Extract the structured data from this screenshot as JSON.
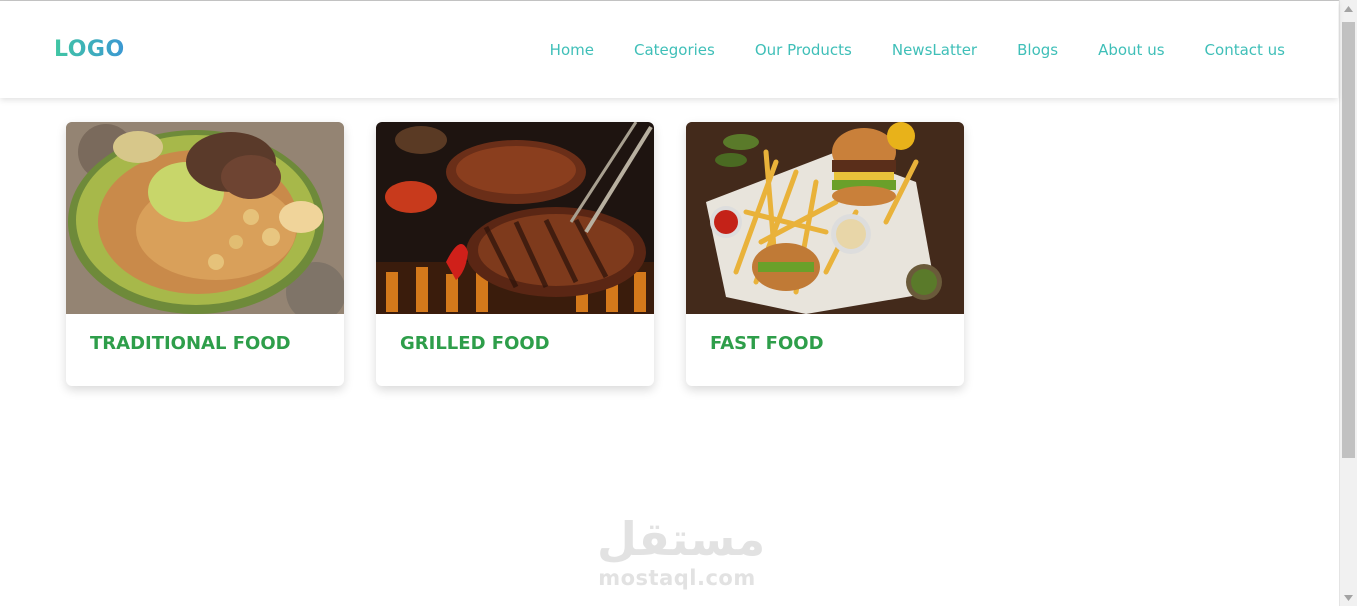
{
  "header": {
    "logo": "LOGO",
    "nav": [
      {
        "label": "Home"
      },
      {
        "label": "Categories"
      },
      {
        "label": "Our Products"
      },
      {
        "label": "NewsLatter"
      },
      {
        "label": "Blogs"
      },
      {
        "label": "About us"
      },
      {
        "label": "Contact us"
      }
    ]
  },
  "categories": [
    {
      "title": "TRADITIONAL FOOD",
      "image": "couscous-plate"
    },
    {
      "title": "GRILLED FOOD",
      "image": "grilled-steak"
    },
    {
      "title": "FAST FOOD",
      "image": "burgers-and-fries"
    }
  ],
  "watermark": {
    "arabic": "مستقل",
    "latin": "mostaql.com"
  },
  "colors": {
    "nav_link": "#3fbfb8",
    "logo_gradient_start": "#41c7a3",
    "logo_gradient_end": "#3b97d3",
    "card_title": "#2e9e4a"
  }
}
